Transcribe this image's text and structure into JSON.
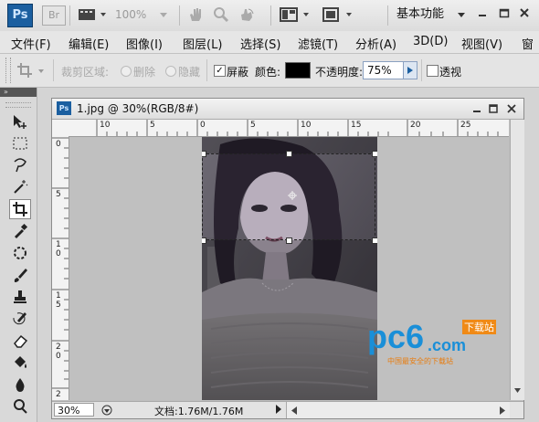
{
  "appbar": {
    "logo": "Ps",
    "bridge": "Br",
    "zoom": "100%",
    "workspace": "基本功能"
  },
  "menu": [
    "文件(F)",
    "编辑(E)",
    "图像(I)",
    "图层(L)",
    "选择(S)",
    "滤镜(T)",
    "分析(A)",
    "3D(D)",
    "视图(V)",
    "窗"
  ],
  "options": {
    "crop_area_label": "裁剪区域:",
    "delete_label": "删除",
    "hide_label": "隐藏",
    "shield_label": "屏蔽",
    "shield_checked": true,
    "color_label": "颜色:",
    "shield_color": "#000000",
    "opacity_label": "不透明度:",
    "opacity_value": "75%",
    "perspective_label": "透视",
    "perspective_checked": false
  },
  "document": {
    "logo": "Ps",
    "title": "1.jpg @ 30%(RGB/8#)",
    "zoom_field": "30%",
    "doc_info": "文档:1.76M/1.76M",
    "h_ruler_labels": [
      "10",
      "5",
      "0",
      "5",
      "10",
      "15",
      "20",
      "25"
    ],
    "v_ruler_labels": [
      "0",
      "5",
      "1\n0",
      "1\n5",
      "2\n0",
      "2"
    ]
  },
  "watermark": {
    "brand": "pc6",
    "domain": ".com",
    "tag": "下载站",
    "slogan": "中国最安全的下载站"
  },
  "colors": {
    "accent": "#1b5fa0",
    "workspace_bg": "#c0c0c0"
  }
}
